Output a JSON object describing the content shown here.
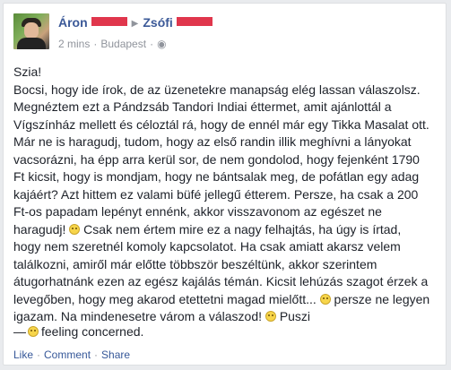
{
  "post": {
    "author": "Áron",
    "recipient": "Zsófi",
    "arrow": "▶",
    "time": "2 mins",
    "location": "Budapest",
    "globe_icon": "globe-icon",
    "lines": [
      "Szia!",
      "Bocsi, hogy ide írok, de az üzenetekre manapság elég lassan válaszolsz.",
      "Megnéztem ezt a Pándzsáb Tandori Indiai éttermet, amit ajánlottál a",
      "Vígszínház mellett és céloztál rá, hogy de ennél már egy Tikka Masalat ott.",
      "Már ne is haragudj, tudom, hogy az első randin illik meghívni a lányokat",
      "vacsorázni, ha épp arra kerül sor, de nem gondolod, hogy fejenként 1790",
      "Ft kicsit, hogy is mondjam, hogy ne bántsalak meg, de pofátlan egy adag",
      "kajáért? Azt hittem ez valami büfé jellegű étterem. Persze, ha csak a 200",
      "Ft-os papadam lepényt ennénk, akkor visszavonom az egészet ne",
      "haragudj!",
      "Csak nem értem mire ez a nagy felhajtás, ha úgy is írtad,",
      "hogy nem szeretnél komoly kapcsolatot. Ha csak amiatt akarsz velem",
      "találkozni, amiről már előtte többször beszéltünk, akkor szerintem",
      "átugorhatnánk ezen az egész kajálás témán. Kicsit lehúzás szagot érzek a",
      "levegőben, hogy meg akarod etettetni magad mielőtt...",
      "persze ne legyen",
      "igazam. Na mindenesetre várom a válaszod!",
      "Puszi"
    ],
    "feeling_prefix": "—",
    "feeling_text": "feeling concerned.",
    "actions": {
      "like": "Like",
      "comment": "Comment",
      "share": "Share",
      "separator": "·"
    }
  }
}
